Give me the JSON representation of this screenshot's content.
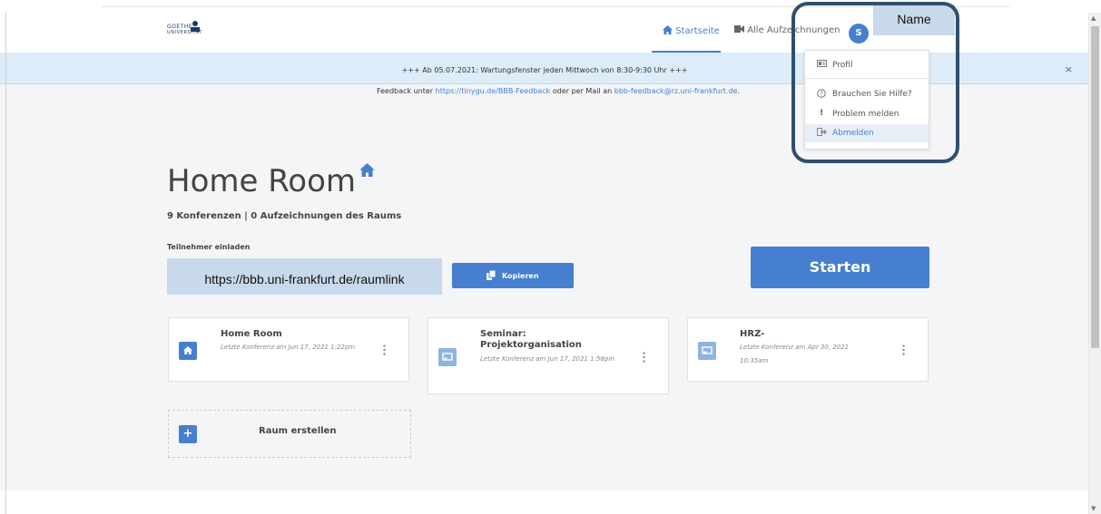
{
  "logo": {
    "line1": "GOETHE",
    "line2": "UNIVERSITÄT"
  },
  "nav": {
    "home": "Startseite",
    "recordings": "Alle Aufzeichnungen",
    "avatar_initial": "S",
    "name": "Name"
  },
  "banner": {
    "text": "+++ Ab 05.07.2021: Wartungsfenster jeden Mittwoch von 8:30-9:30 Uhr +++",
    "close": "×"
  },
  "feedback": {
    "prefix": "Feedback unter ",
    "link1": "https://tinygu.de/BBB-Feedback",
    "middle": " oder per Mail an ",
    "link2": "bbb-feedback@rz.uni-frankfurt.de",
    "suffix": "."
  },
  "dropdown": {
    "items": [
      {
        "label": "Profil",
        "icon": "id-card-icon"
      },
      {
        "label": "Brauchen Sie Hilfe?",
        "icon": "question-circle-icon"
      },
      {
        "label": "Problem melden",
        "icon": "exclamation-icon"
      },
      {
        "label": "Abmelden",
        "icon": "sign-out-icon"
      }
    ]
  },
  "room": {
    "title": "Home Room",
    "subtitle": "9 Konferenzen | 0 Aufzeichnungen des Raums",
    "invite_label": "Teilnehmer einladen",
    "link": "https://bbb.uni-frankfurt.de/raumlink",
    "copy": "Kopieren",
    "start": "Starten"
  },
  "cards": [
    {
      "name": "Home Room",
      "meta": "Letzte Konferenz am Jun 17, 2021 1:22pm",
      "icon": "home-icon"
    },
    {
      "name": "Seminar: Projektorganisation",
      "meta": "Letzte Konferenz am Jun 17, 2021 1:58pm",
      "icon": "chalkboard-icon"
    },
    {
      "name": "HRZ-",
      "meta": "Letzte Konferenz am Apr 30, 2021 10:35am",
      "icon": "chalkboard-icon"
    }
  ],
  "create": {
    "label": "Raum erstellen",
    "plus": "+"
  },
  "colors": {
    "accent": "#467fcf",
    "banner": "#dcecf8",
    "highlight_border": "#2f4f6e",
    "annotation_fill": "#c9d9ec"
  }
}
